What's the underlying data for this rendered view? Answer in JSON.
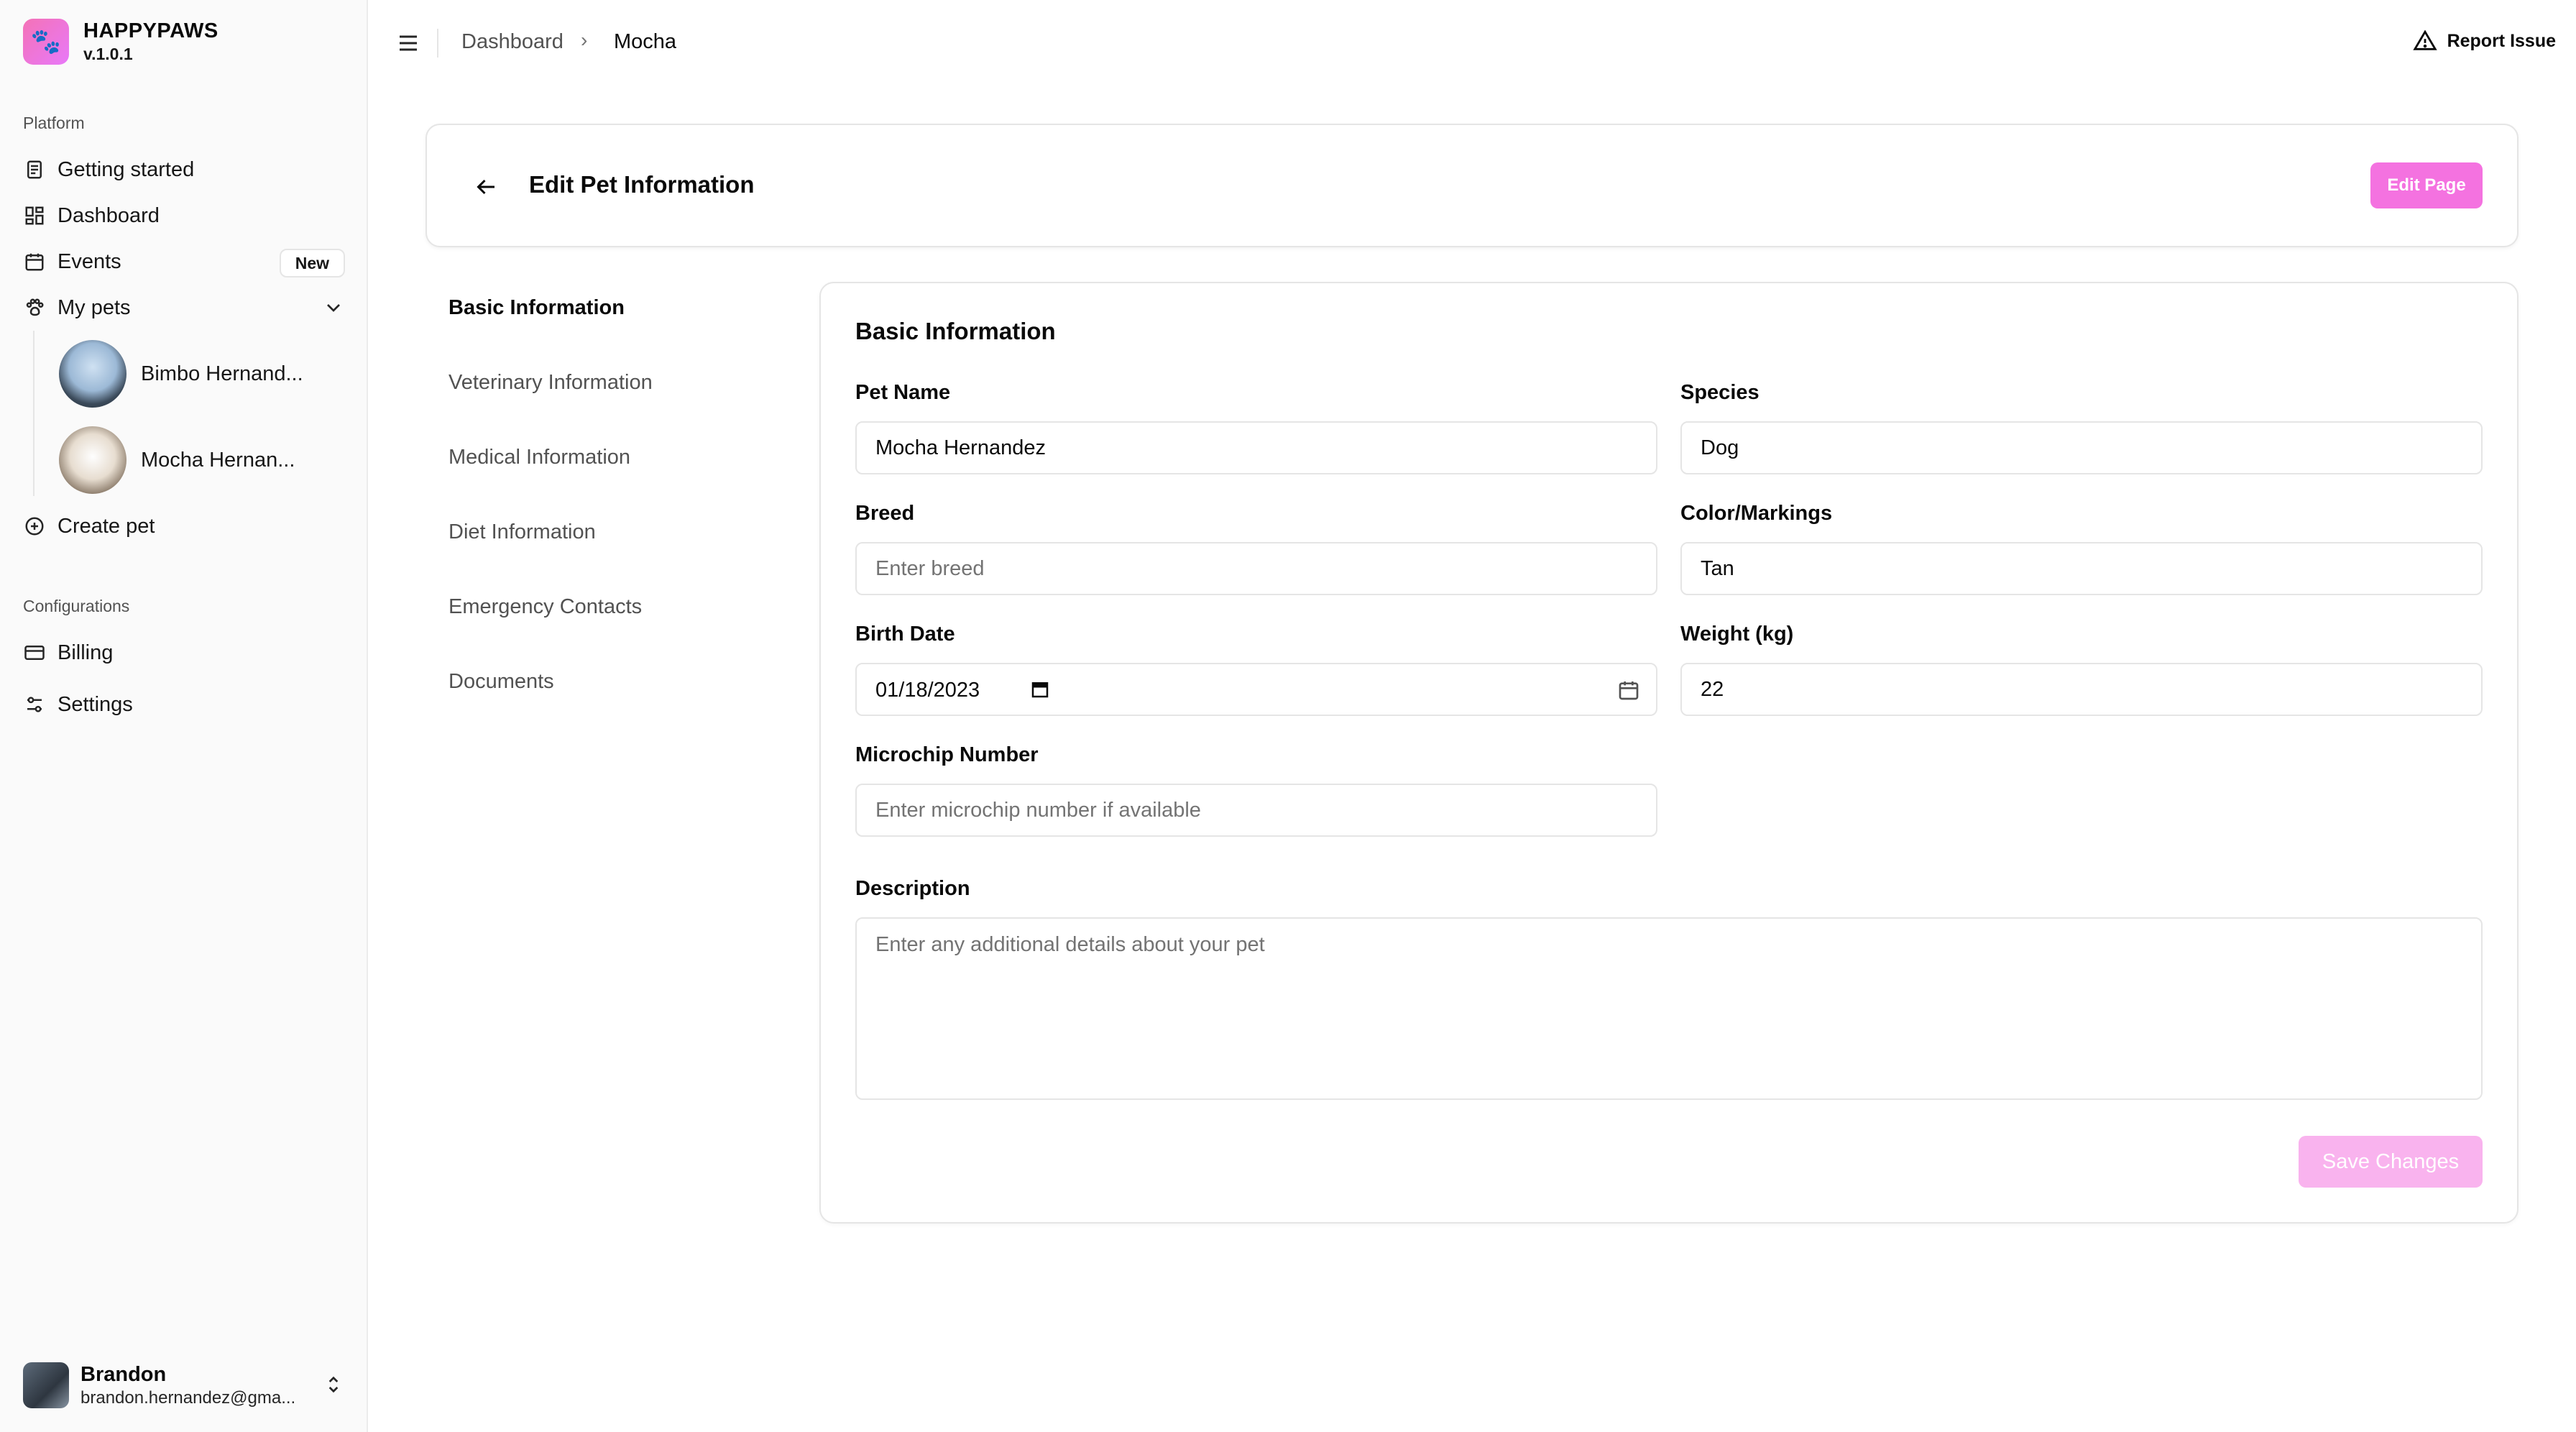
{
  "brand": {
    "name": "HAPPYPAWS",
    "version": "v.1.0.1"
  },
  "sidebar": {
    "platform_label": "Platform",
    "items": [
      {
        "label": "Getting started",
        "icon": "file-text-icon"
      },
      {
        "label": "Dashboard",
        "icon": "layout-grid-icon"
      },
      {
        "label": "Events",
        "icon": "calendar-icon",
        "badge": "New"
      },
      {
        "label": "My pets",
        "icon": "paw-icon"
      }
    ],
    "pets": [
      {
        "name": "Bimbo Hernand..."
      },
      {
        "name": "Mocha Hernan..."
      }
    ],
    "create_pet": "Create pet",
    "config_label": "Configurations",
    "config_items": [
      {
        "label": "Billing",
        "icon": "credit-card-icon"
      },
      {
        "label": "Settings",
        "icon": "sliders-icon"
      }
    ],
    "user": {
      "name": "Brandon",
      "email": "brandon.hernandez@gma..."
    }
  },
  "topbar": {
    "breadcrumb": {
      "parent": "Dashboard",
      "separator": "›",
      "current": "Mocha"
    },
    "report_label": "Report Issue"
  },
  "header": {
    "title": "Edit Pet Information",
    "edit_button": "Edit Page"
  },
  "sections": [
    "Basic Information",
    "Veterinary Information",
    "Medical Information",
    "Diet Information",
    "Emergency Contacts",
    "Documents"
  ],
  "form": {
    "title": "Basic Information",
    "pet_name": {
      "label": "Pet Name",
      "value": "Mocha Hernandez"
    },
    "species": {
      "label": "Species",
      "value": "Dog"
    },
    "breed": {
      "label": "Breed",
      "placeholder": "Enter breed"
    },
    "color": {
      "label": "Color/Markings",
      "value": "Tan"
    },
    "birth_date": {
      "label": "Birth Date",
      "value": "01/18/2023"
    },
    "weight": {
      "label": "Weight (kg)",
      "value": "22"
    },
    "microchip": {
      "label": "Microchip Number",
      "placeholder": "Enter microchip number if available"
    },
    "description": {
      "label": "Description",
      "placeholder": "Enter any additional details about your pet"
    },
    "save_button": "Save Changes"
  },
  "colors": {
    "accent": "#f472e0",
    "accent_disabled": "#f9b3ee"
  }
}
